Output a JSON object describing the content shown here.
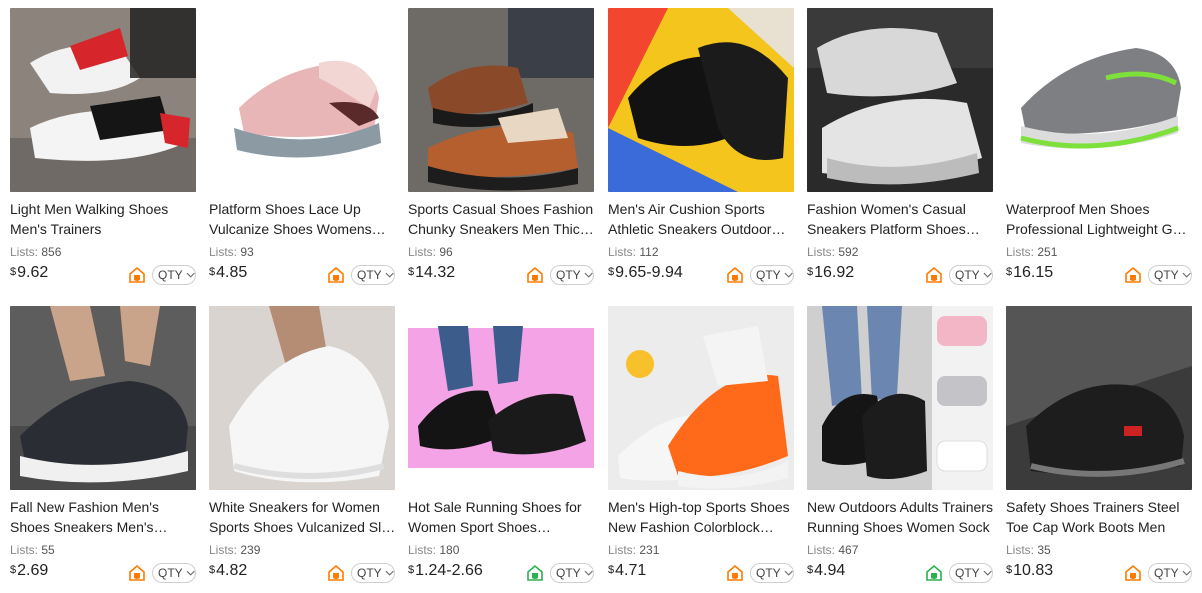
{
  "currency_symbol": "$",
  "lists_label": "Lists:",
  "qty_label": "QTY",
  "colors": {
    "shield_orange": "#ff7a00",
    "shield_green": "#2bb24c"
  },
  "products": [
    {
      "title": "Light Men Walking Shoes Men's Trainers",
      "lists": "856",
      "price": "9.62",
      "shield": "orange"
    },
    {
      "title": "Platform Shoes Lace Up Vulcanize Shoes Womens Casual Sneakers",
      "lists": "93",
      "price": "4.85",
      "shield": "orange"
    },
    {
      "title": "Sports Casual Shoes Fashion Chunky Sneakers Men Thick Sole",
      "lists": "96",
      "price": "14.32",
      "shield": "orange"
    },
    {
      "title": "Men's Air Cushion Sports Athletic Sneakers Outdoor Running",
      "lists": "112",
      "price": "9.65-9.94",
      "shield": "orange"
    },
    {
      "title": "Fashion Women's Casual Sneakers Platform Shoes Ladies",
      "lists": "592",
      "price": "16.92",
      "shield": "orange"
    },
    {
      "title": "Waterproof Men Shoes Professional Lightweight Golf Shoes",
      "lists": "251",
      "price": "16.15",
      "shield": "orange"
    },
    {
      "title": "Fall New Fashion Men's Shoes Sneakers Men's Running Shoes",
      "lists": "55",
      "price": "2.69",
      "shield": "orange"
    },
    {
      "title": "White Sneakers for Women Sports Shoes Vulcanized Slip On",
      "lists": "239",
      "price": "4.82",
      "shield": "orange"
    },
    {
      "title": "Hot Sale Running Shoes for Women Sport Shoes Breathable",
      "lists": "180",
      "price": "1.24-2.66",
      "shield": "green"
    },
    {
      "title": "Men's High-top Sports Shoes New Fashion Colorblock Sneakers",
      "lists": "231",
      "price": "4.71",
      "shield": "orange"
    },
    {
      "title": "New Outdoors Adults Trainers Running Shoes Women Sock",
      "lists": "467",
      "price": "4.94",
      "shield": "green"
    },
    {
      "title": "Safety Shoes Trainers Steel Toe Cap Work Boots Men",
      "lists": "35",
      "price": "10.83",
      "shield": "orange"
    }
  ]
}
